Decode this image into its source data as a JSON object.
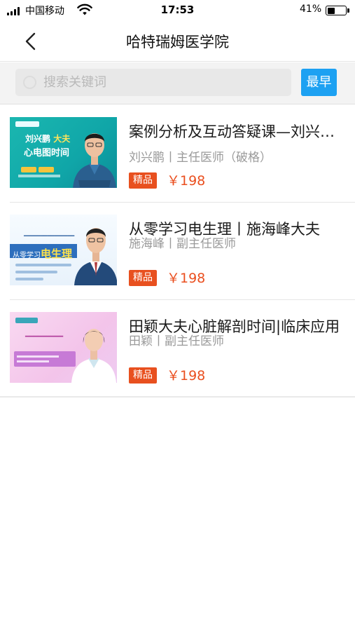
{
  "status_bar": {
    "carrier": "中国移动",
    "time": "17:53",
    "battery_percent": "41%",
    "battery_level": 0.41
  },
  "nav": {
    "title": "哈特瑞姆医学院",
    "back_icon": "chevron-left-icon"
  },
  "search": {
    "placeholder": "搜索关键词",
    "value": "",
    "sort_label": "最早",
    "colors": {
      "sort_bg": "#1da1f2",
      "box_bg": "#e8e8e8"
    }
  },
  "courses": [
    {
      "title": "案例分析及互动答疑课—刘兴鹏大夫心电图时间",
      "meta": "刘兴鹏丨主任医师（破格）",
      "badge": "精品",
      "price": "￥198",
      "thumb_text": [
        "刘兴鹏",
        "大夫",
        "心电图时间"
      ]
    },
    {
      "title": "从零学习电生理丨施海峰大夫",
      "meta": "施海峰丨副主任医师",
      "badge": "精品",
      "price": "￥198",
      "thumb_text": [
        "从零学习",
        "电生理"
      ]
    },
    {
      "title": "田颖大夫心脏解剖时间|临床应用",
      "meta": "田颖丨副主任医师",
      "badge": "精品",
      "price": "￥198",
      "thumb_text": []
    }
  ],
  "colors": {
    "accent": "#1da1f2",
    "price": "#ea4f1f",
    "badge": "#e8501f"
  }
}
